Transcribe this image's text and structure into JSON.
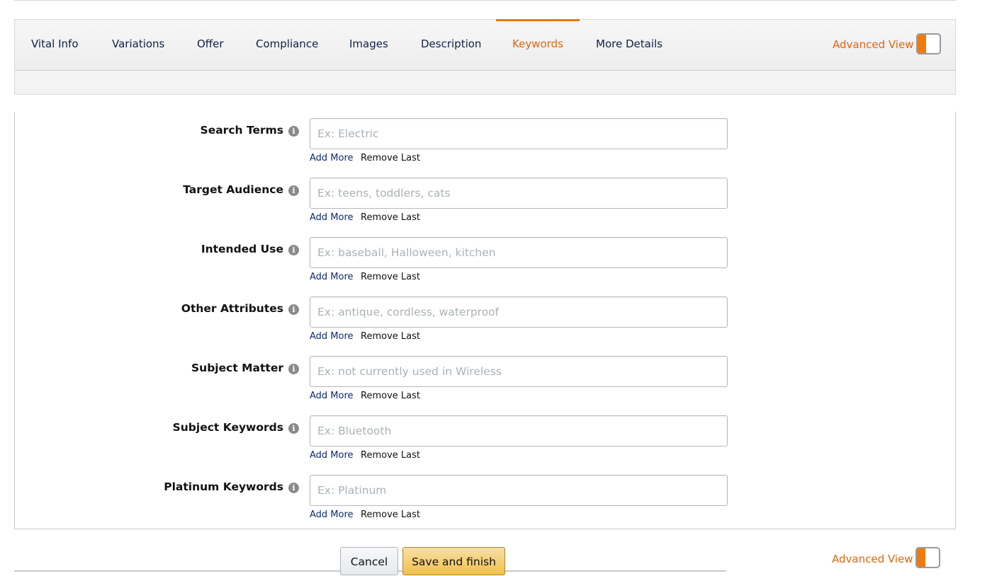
{
  "tabs": [
    {
      "label": "Vital Info",
      "active": false
    },
    {
      "label": "Variations",
      "active": false
    },
    {
      "label": "Offer",
      "active": false
    },
    {
      "label": "Compliance",
      "active": false
    },
    {
      "label": "Images",
      "active": false
    },
    {
      "label": "Description",
      "active": false
    },
    {
      "label": "Keywords",
      "active": true
    },
    {
      "label": "More Details",
      "active": false
    }
  ],
  "advanced_view": {
    "label": "Advanced View",
    "enabled": true
  },
  "fields": [
    {
      "label": "Search Terms",
      "placeholder": "Ex: Electric",
      "value": ""
    },
    {
      "label": "Target Audience",
      "placeholder": "Ex: teens, toddlers, cats",
      "value": ""
    },
    {
      "label": "Intended Use",
      "placeholder": "Ex: baseball, Halloween, kitchen",
      "value": ""
    },
    {
      "label": "Other Attributes",
      "placeholder": "Ex: antique, cordless, waterproof",
      "value": ""
    },
    {
      "label": "Subject Matter",
      "placeholder": "Ex: not currently used in Wireless",
      "value": ""
    },
    {
      "label": "Subject Keywords",
      "placeholder": "Ex: Bluetooth",
      "value": ""
    },
    {
      "label": "Platinum Keywords",
      "placeholder": "Ex: Platinum",
      "value": ""
    }
  ],
  "field_actions": {
    "add_more": "Add More",
    "remove_last": "Remove Last"
  },
  "info_glyph": "i",
  "actions": {
    "cancel": "Cancel",
    "save": "Save and finish"
  },
  "colors": {
    "accent": "#e1650f",
    "toggle": "#f07b0c",
    "link": "#0b2a73",
    "save_button": "#f0c14b"
  }
}
